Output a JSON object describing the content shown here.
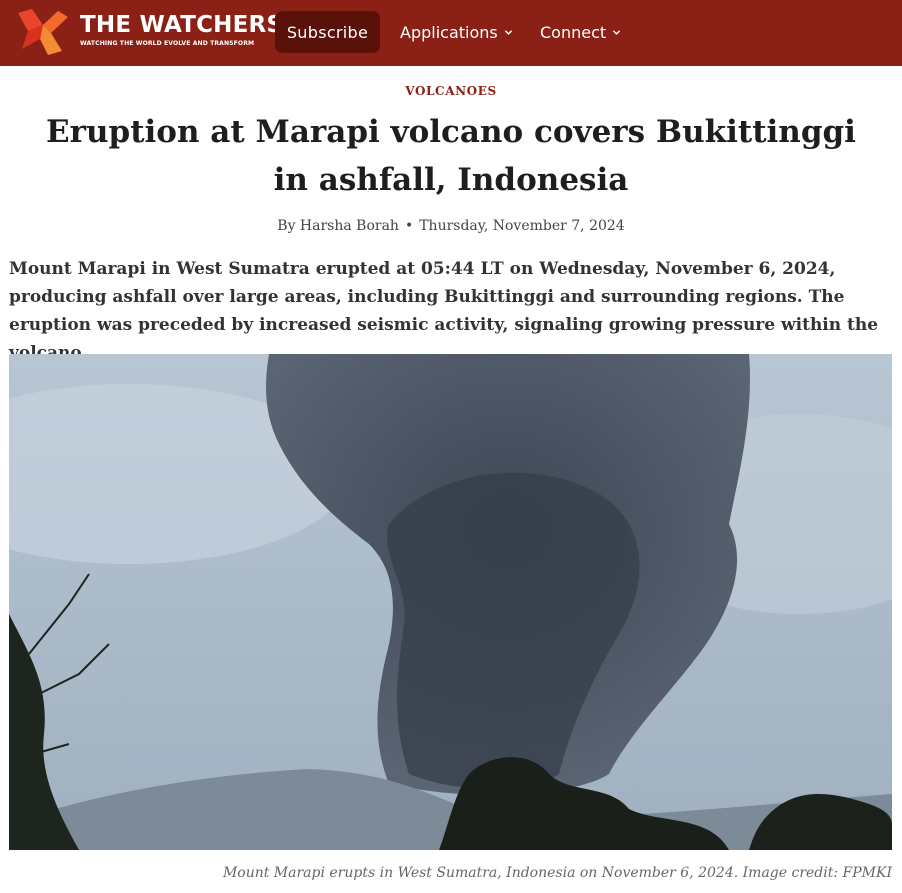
{
  "site": {
    "name": "THE WATCHERS",
    "tagline": "WATCHING THE WORLD EVOLVE AND TRANSFORM",
    "brand_color": "#8b2116"
  },
  "nav": {
    "subscribe_label": "Subscribe",
    "items": [
      {
        "label": "Applications",
        "icon": "chevron-down-icon"
      },
      {
        "label": "Connect",
        "icon": "chevron-down-icon"
      }
    ]
  },
  "article": {
    "category": "VOLCANOES",
    "title": "Eruption at Marapi volcano covers Bukittinggi in ashfall, Indonesia",
    "author": "By Harsha Borah",
    "separator": "•",
    "date": "Thursday, November 7, 2024",
    "lead": "Mount Marapi in West Sumatra erupted at 05:44 LT on Wednesday, November 6, 2024, producing ashfall over large areas, including Bukittinggi and surrounding regions. The eruption was preceded by increased seismic activity, signaling growing pressure within the volcano.",
    "image_caption": "Mount Marapi erupts in West Sumatra, Indonesia on November 6, 2024. Image credit: FPMKI"
  }
}
